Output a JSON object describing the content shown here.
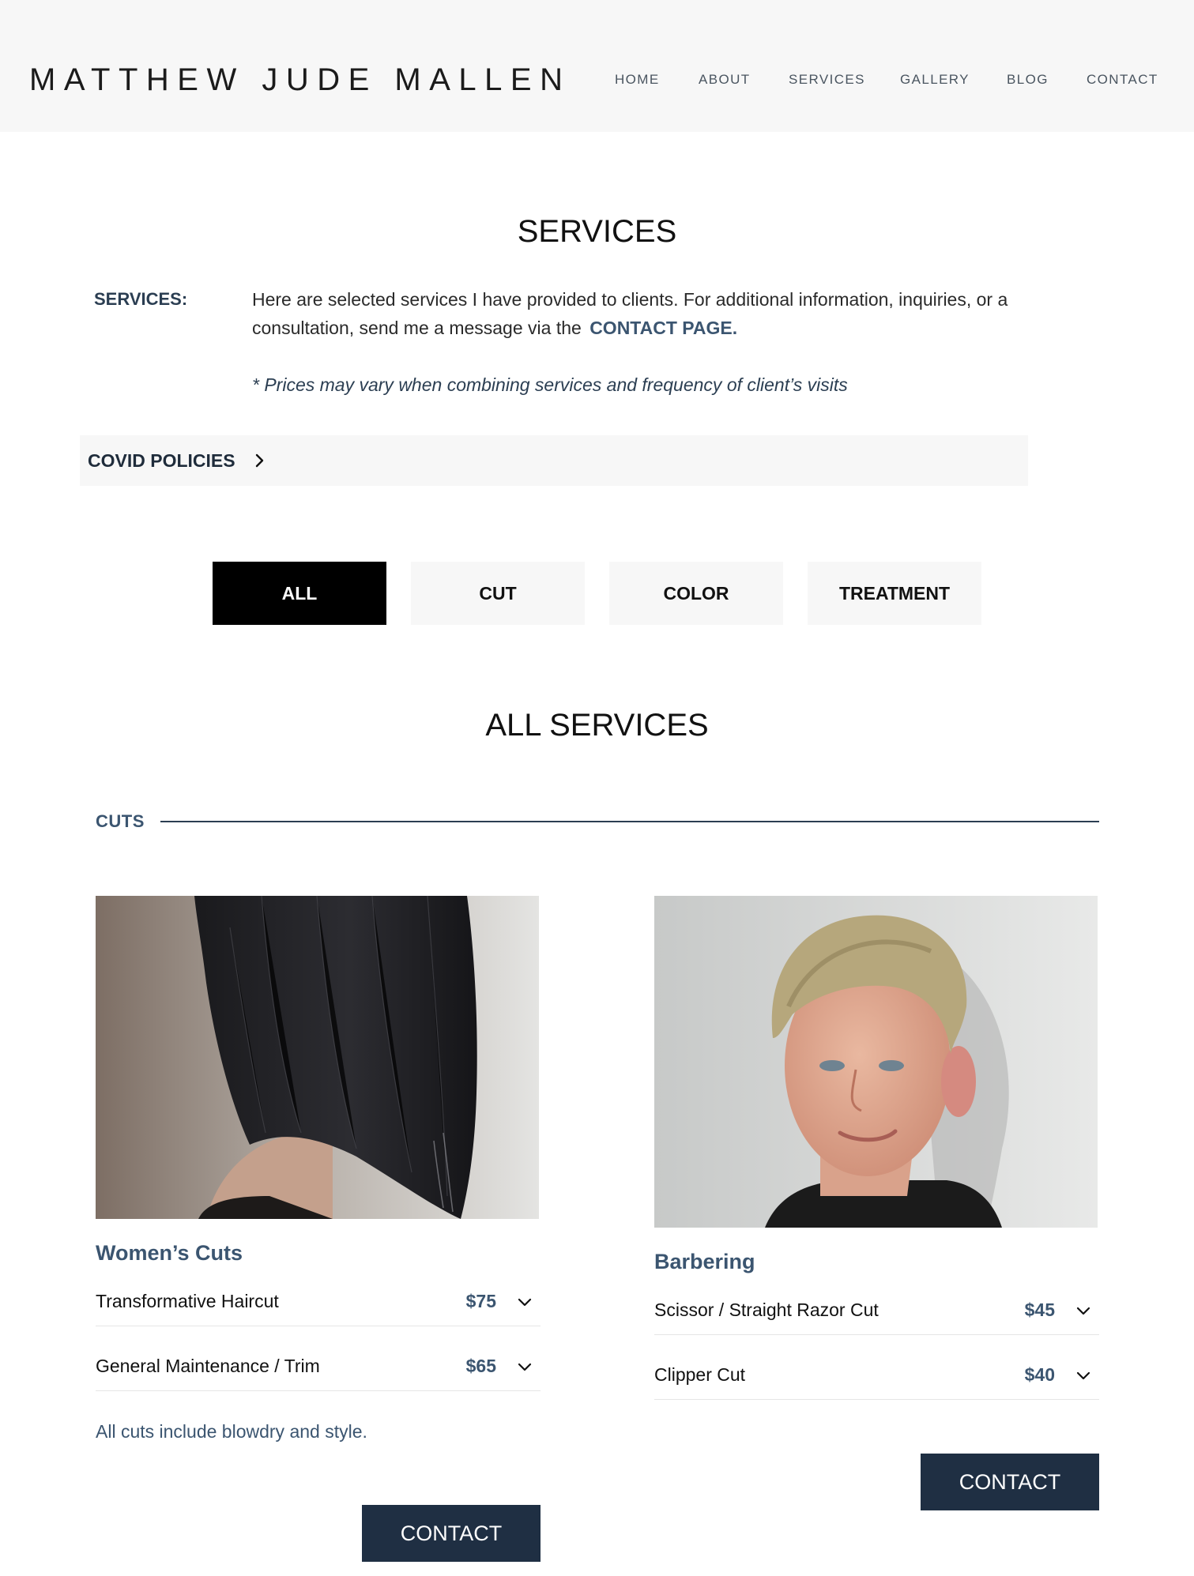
{
  "header": {
    "brand": "MATTHEW JUDE MALLEN",
    "nav": [
      "HOME",
      "ABOUT",
      "SERVICES",
      "GALLERY",
      "BLOG",
      "CONTACT"
    ]
  },
  "intro": {
    "title": "SERVICES",
    "label": "SERVICES:",
    "text": "Here are selected services I have provided to clients. For additional information, inquiries, or a consultation, send me a message via the",
    "link_label": "CONTACT PAGE.",
    "note": "* Prices may vary when combining services and frequency of client’s visits"
  },
  "covid": {
    "label": "COVID POLICIES",
    "icon": "chevron-right-icon"
  },
  "filters": {
    "tabs": [
      "ALL",
      "CUT",
      "COLOR",
      "TREATMENT"
    ],
    "active": "ALL"
  },
  "all_services": {
    "title": "ALL SERVICES"
  },
  "cuts": {
    "label": "CUTS",
    "cards": [
      {
        "title": "Women’s Cuts",
        "items": [
          {
            "name": "Transformative Haircut",
            "price": "$75"
          },
          {
            "name": "General Maintenance / Trim",
            "price": "$65"
          }
        ],
        "footnote": "All cuts include blowdry and style.",
        "button": "CONTACT"
      },
      {
        "title": "Barbering",
        "items": [
          {
            "name": "Scissor / Straight Razor Cut",
            "price": "$45"
          },
          {
            "name": "Clipper Cut",
            "price": "$40"
          }
        ],
        "button": "CONTACT"
      }
    ]
  },
  "colors": {
    "accent": "#3b5570",
    "dark_button": "#1f2f43",
    "header_bg": "#f7f7f7"
  }
}
